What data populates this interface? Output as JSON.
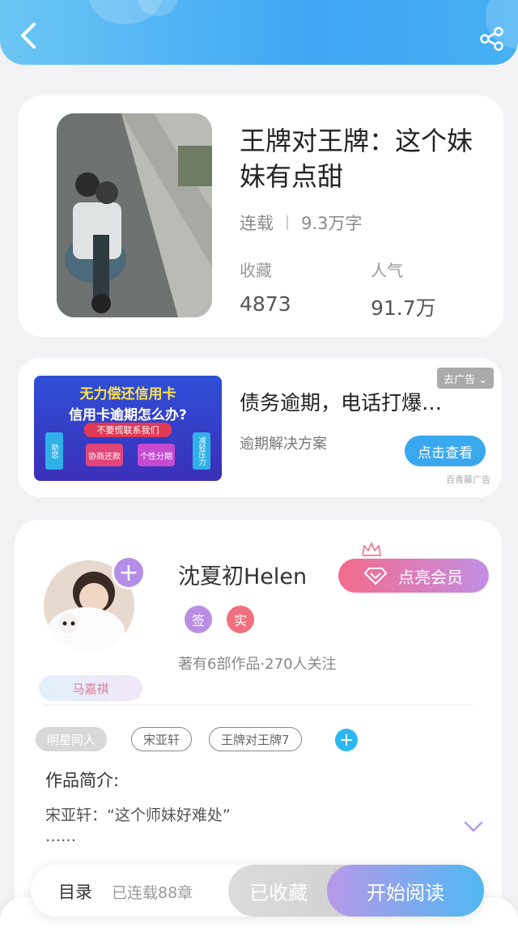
{
  "header": {
    "back_icon": "chevron-left-icon",
    "share_icon": "share-icon",
    "colors": {
      "from": "#6cc6f4",
      "to": "#3ea6f3"
    }
  },
  "book": {
    "title": "王牌对王牌：这个妹妹有点甜",
    "status": "连载",
    "word_count": "9.3万字",
    "favorites_label": "收藏",
    "favorites_value": "4873",
    "popularity_label": "人气",
    "popularity_value": "91.7万"
  },
  "ad": {
    "image_line1": "无力偿还信用卡",
    "image_line2": "信用卡逾期怎么办?",
    "image_line3": "不要慌联系我们",
    "image_chip1": "协商还款",
    "image_chip2": "个性分期",
    "image_side_left": "助您",
    "image_side_right": "减轻压力",
    "title": "债务逾期，电话打爆…",
    "subtitle": "逾期解决方案",
    "tag_label": "去广告 ⌄",
    "button_label": "点击查看",
    "source": "百青藤广告"
  },
  "author": {
    "name": "沈夏初Helen",
    "vip_label": "点亮会员",
    "badge_sign": "签",
    "badge_real": "实",
    "meta": "著有6部作品·270人关注",
    "fan_badge": "马嘉祺",
    "follow_symbol": "+"
  },
  "tags": [
    {
      "label": "明星同人"
    },
    {
      "label": "宋亚轩"
    },
    {
      "label": "王牌对王牌7"
    }
  ],
  "intro": {
    "label": "作品简介:",
    "line1": "宋亚轩：“这个师妹好难处”",
    "line2": "……"
  },
  "bottom": {
    "catalog": "目录",
    "chapters": "已连载88章",
    "collected": "已收藏",
    "read": "开始阅读"
  }
}
